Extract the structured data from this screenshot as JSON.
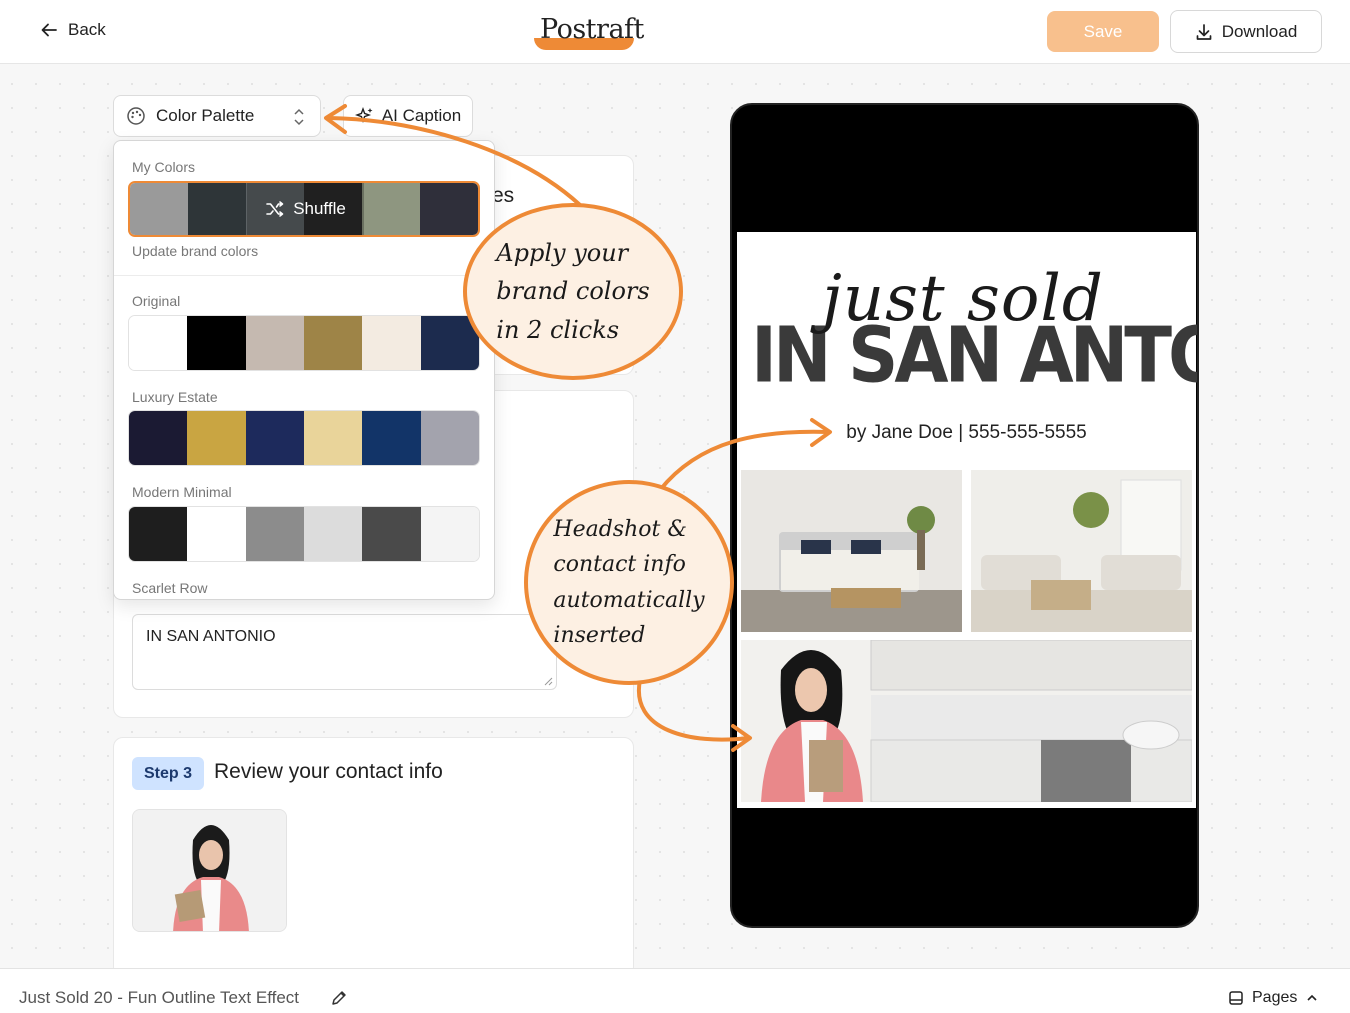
{
  "header": {
    "back_label": "Back",
    "logo_text": "Postraft",
    "save_label": "Save",
    "download_label": "Download"
  },
  "toolbar": {
    "palette_select_value": "Color Palette",
    "ai_caption_label": "AI Caption"
  },
  "palette_dropdown": {
    "my_colors_label": "My Colors",
    "my_colors": [
      "#9a9a9a",
      "#2e3538",
      "#5d6366",
      "#2b2b2b",
      "#8e9680",
      "#2f2f3a"
    ],
    "shuffle_label": "Shuffle",
    "update_link": "Update brand colors",
    "palettes": [
      {
        "name": "Original",
        "colors": [
          "#ffffff",
          "#000000",
          "#c5b9b0",
          "#9e8447",
          "#f3ebe1",
          "#1c2b4e"
        ]
      },
      {
        "name": "Luxury Estate",
        "colors": [
          "#1b1a33",
          "#c9a542",
          "#1d2a5c",
          "#e9d49a",
          "#123468",
          "#a3a3ad"
        ]
      },
      {
        "name": "Modern Minimal",
        "colors": [
          "#1e1e1e",
          "#ffffff",
          "#8c8c8c",
          "#dcdcdc",
          "#4a4a4a",
          "#f4f4f4"
        ]
      },
      {
        "name": "Scarlet Row",
        "colors": []
      }
    ]
  },
  "behind_text": {
    "partial_heading": "es"
  },
  "text_field": {
    "value": "IN SAN ANTONIO"
  },
  "step3": {
    "chip": "Step 3",
    "title": "Review your contact info"
  },
  "footer": {
    "doc_title": "Just Sold 20 - Fun Outline Text Effect",
    "pages_label": "Pages"
  },
  "poster": {
    "script_title": "just sold",
    "block_title": "IN SAN ANTONIO",
    "byline": "by Jane Doe  |  555-555-5555"
  },
  "annotations": {
    "bubble1": [
      "Apply your",
      "brand colors",
      "in 2 clicks"
    ],
    "bubble2": [
      "Headshot &",
      "contact info",
      "automatically",
      "inserted"
    ]
  },
  "colors": {
    "accent": "#ee8a36",
    "save_disabled": "#f8c08d",
    "step_chip": "#cfe3ff"
  }
}
